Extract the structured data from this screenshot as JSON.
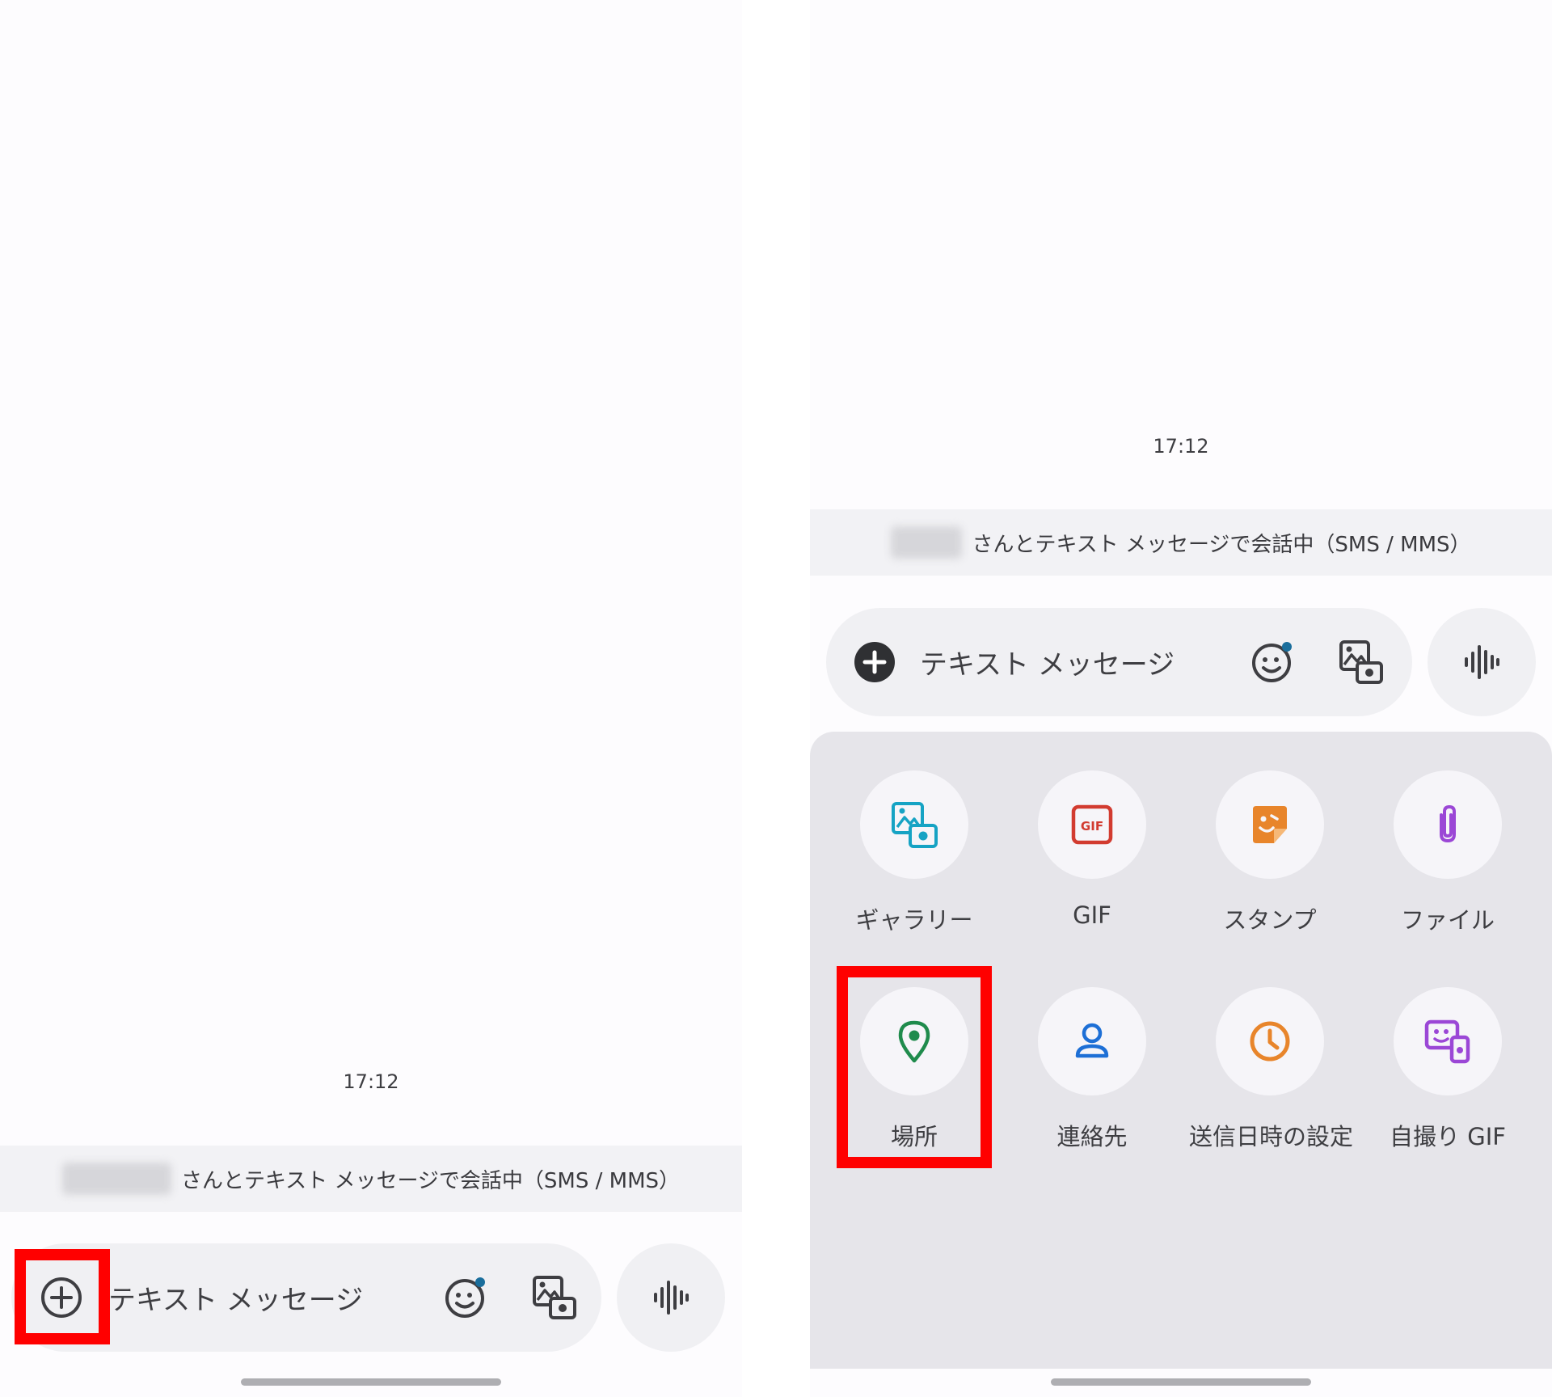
{
  "left": {
    "timestamp": "17:12",
    "banner_text": "さんとテキスト メッセージで会話中（SMS / MMS）",
    "compose_placeholder": "テキスト メッセージ",
    "icons": {
      "add": "plus-circle-outline-icon",
      "emoji": "emoji-smile-icon",
      "gallery": "gallery-icon",
      "voice": "voice-waveform-icon"
    }
  },
  "right": {
    "timestamp": "17:12",
    "banner_text": "さんとテキスト メッセージで会話中（SMS / MMS）",
    "compose_placeholder": "テキスト メッセージ",
    "attachments": [
      {
        "label": "ギャラリー",
        "icon": "gallery-icon",
        "color": "#16a3c4"
      },
      {
        "label": "GIF",
        "icon": "gif-icon",
        "color": "#d23b30"
      },
      {
        "label": "スタンプ",
        "icon": "sticker-icon",
        "color": "#e8852b"
      },
      {
        "label": "ファイル",
        "icon": "paperclip-icon",
        "color": "#9b47d6"
      },
      {
        "label": "場所",
        "icon": "location-pin-icon",
        "color": "#1f8b4c"
      },
      {
        "label": "連絡先",
        "icon": "contact-person-icon",
        "color": "#1d6fd6"
      },
      {
        "label": "送信日時の設定",
        "icon": "clock-icon",
        "color": "#e8852b"
      },
      {
        "label": "自撮り GIF",
        "icon": "selfie-gif-icon",
        "color": "#9b47d6"
      }
    ]
  },
  "colors": {
    "highlight": "#ff0000",
    "panel_bg": "#fdfcfe",
    "tray_bg": "#e6e5ea"
  }
}
